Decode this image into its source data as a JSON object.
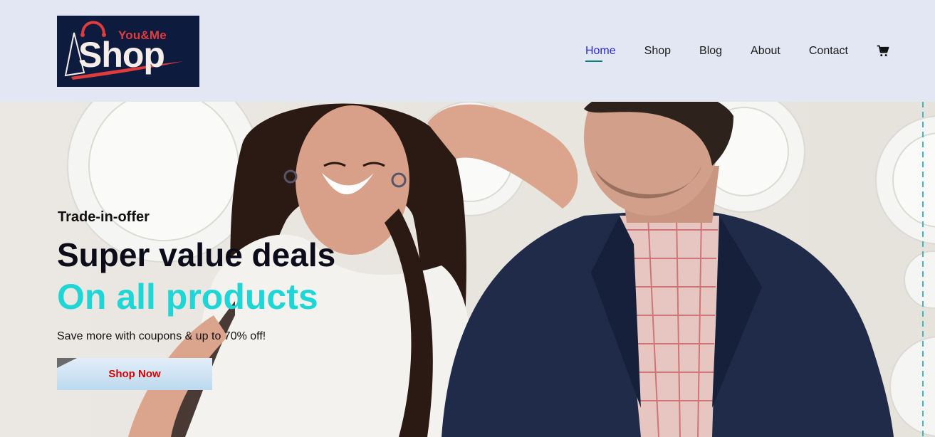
{
  "brand": {
    "logo_small": "You&Me",
    "logo_big": "Shop",
    "colors": {
      "logo_bg": "#0d1b3e",
      "logo_accent": "#e03c3c",
      "header_bg": "#e3e6f3",
      "accent_teal": "#1fd6d6",
      "nav_active": "#2a2ad0",
      "button_text": "#d40000"
    }
  },
  "nav": {
    "items": [
      {
        "label": "Home",
        "active": true
      },
      {
        "label": "Shop",
        "active": false
      },
      {
        "label": "Blog",
        "active": false
      },
      {
        "label": "About",
        "active": false
      },
      {
        "label": "Contact",
        "active": false
      }
    ],
    "cart_icon": "shopping-cart-icon"
  },
  "hero": {
    "subtitle": "Trade-in-offer",
    "headline": "Super value deals",
    "headline_accent": "On all products",
    "description": "Save more with coupons & up to 70% off!",
    "button_label": "Shop Now"
  }
}
